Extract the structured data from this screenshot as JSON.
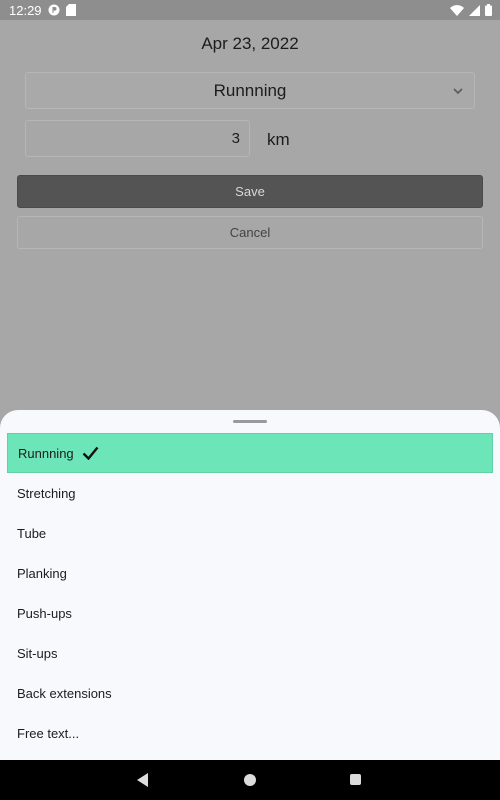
{
  "status_bar": {
    "time": "12:29"
  },
  "form": {
    "date": "Apr 23, 2022",
    "activity": "Runnning",
    "distance_value": "3",
    "distance_unit": "km",
    "save_label": "Save",
    "cancel_label": "Cancel"
  },
  "sheet": {
    "options": [
      {
        "label": "Runnning",
        "selected": true
      },
      {
        "label": "Stretching",
        "selected": false
      },
      {
        "label": "Tube",
        "selected": false
      },
      {
        "label": "Planking",
        "selected": false
      },
      {
        "label": "Push-ups",
        "selected": false
      },
      {
        "label": "Sit-ups",
        "selected": false
      },
      {
        "label": "Back extensions",
        "selected": false
      },
      {
        "label": "Free text...",
        "selected": false
      }
    ]
  },
  "colors": {
    "selected_option_bg": "#6ce6b8",
    "scrim": "#a7a7a7",
    "save_button_bg": "#545454"
  },
  "icons": [
    "chevron-down-icon",
    "check-icon",
    "back-icon",
    "home-icon",
    "recents-icon"
  ]
}
